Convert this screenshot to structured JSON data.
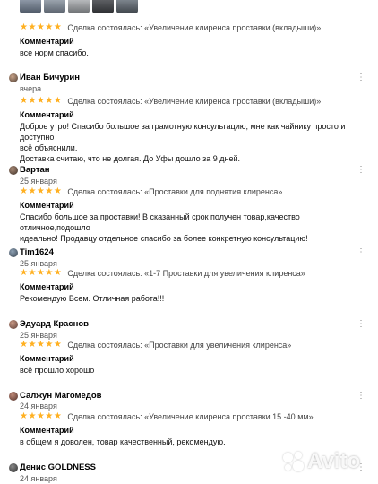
{
  "colors": {
    "star": "#ffb021",
    "text": "#000000",
    "muted": "#555555"
  },
  "top_review": {
    "stars": "★★★★★",
    "deal": "Сделка состоялась: «Увеличение клиренса проставки (вкладыши)»",
    "comment_title": "Комментарий",
    "text": [
      "все норм спасибо."
    ]
  },
  "reviews": [
    {
      "author": "Иван Бичурин",
      "date": "вчера",
      "stars": "★★★★★",
      "deal": "Сделка состоялась: «Увеличение клиренса проставки (вкладыши)»",
      "comment_title": "Комментарий",
      "text": [
        "Доброе утро! Спасибо большое за грамотную консультацию, мне как чайнику просто и доступно",
        "всё объяснили.",
        "Доставка считаю, что не долгая. До Уфы дошло за 9 дней."
      ],
      "more_icon": "⋮"
    },
    {
      "author": "Вартан",
      "date": "25 января",
      "stars": "★★★★★",
      "deal": "Сделка состоялась: «Проставки для поднятия клиренса»",
      "comment_title": "Комментарий",
      "text": [
        "Спасибо большое за проставки! В сказанный срок получен товар,качество отличное,подошло",
        "идеально! Продавцу отдельное спасибо за более конкретную консультацию!"
      ],
      "more_icon": "⋮"
    },
    {
      "author": "Tim1624",
      "date": "25 января",
      "stars": "★★★★★",
      "deal": "Сделка состоялась: «1-7 Проставки для увеличения клиренса»",
      "comment_title": "Комментарий",
      "text": [
        "Рекомендую Всем. Отличная работа!!!"
      ],
      "more_icon": "⋮"
    },
    {
      "author": "Эдуард Краснов",
      "date": "25 января",
      "stars": "★★★★★",
      "deal": "Сделка состоялась: «Проставки для увеличения клиренса»",
      "comment_title": "Комментарий",
      "text": [
        "всё прошло хорошо"
      ],
      "more_icon": "⋮"
    },
    {
      "author": "Салжун Магомедов",
      "date": "24 января",
      "stars": "★★★★★",
      "deal": "Сделка состоялась: «Увеличение клиренса проставки 15 -40 мм»",
      "comment_title": "Комментарий",
      "text": [
        "в общем я доволен, товар качественный, рекомендую."
      ],
      "more_icon": "⋮"
    },
    {
      "author": "Денис GOLDNESS",
      "date": "24 января",
      "more_icon": "⋮"
    }
  ],
  "watermark": "Avito"
}
